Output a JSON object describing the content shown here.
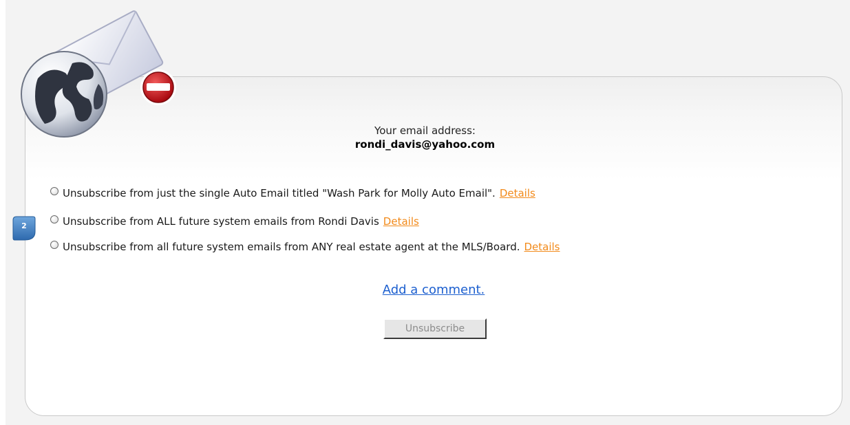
{
  "email": {
    "label": "Your email address:",
    "address": "rondi_davis@yahoo.com"
  },
  "options": [
    {
      "text": "Unsubscribe from just the single Auto Email titled \"Wash Park for Molly Auto Email\".",
      "details": "Details"
    },
    {
      "text": "Unsubscribe from ALL future system emails from Rondi Davis",
      "details": "Details"
    },
    {
      "text": "Unsubscribe from all future system emails from ANY real estate agent at the MLS/Board.",
      "details": "Details"
    }
  ],
  "comment_link": "Add a comment.",
  "unsubscribe_button": "Unsubscribe",
  "step_badge": "2",
  "icons": {
    "logo": "email-globe-remove-icon",
    "badge": "step-marker-icon"
  },
  "colors": {
    "details_link": "#f28a1a",
    "comment_link": "#1c5fcf",
    "badge": "#3f7fc4",
    "remove_icon": "#c0161d"
  }
}
